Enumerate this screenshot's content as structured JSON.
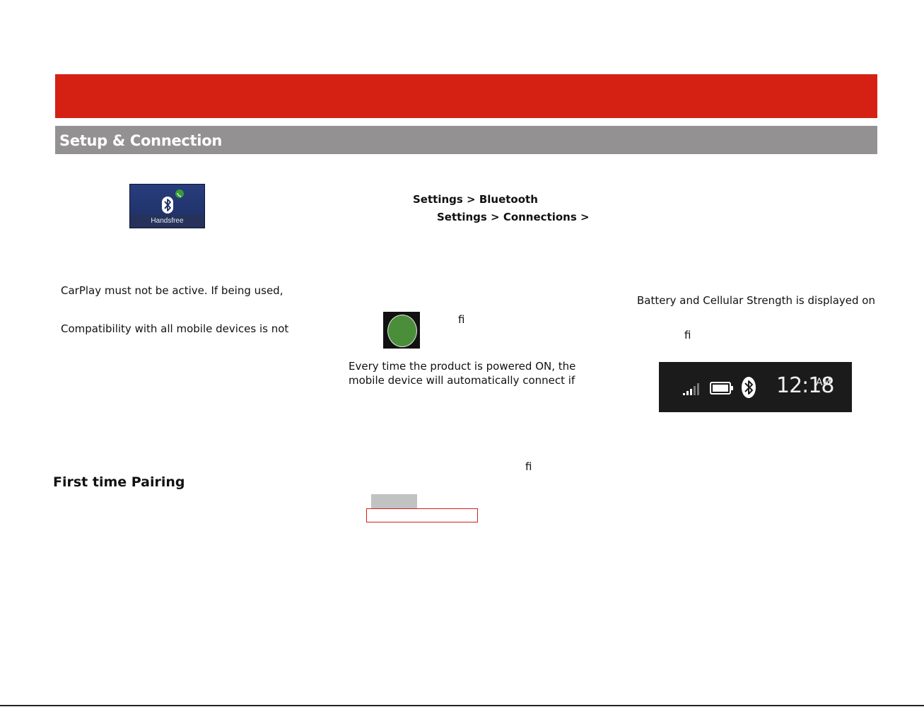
{
  "section": {
    "title": "Setup & Connection"
  },
  "handsfree_tile": {
    "label": "Handsfree"
  },
  "left_col": {
    "carplay_note": "CarPlay must not be active. If being used,",
    "compat_note": "Compatibility with all mobile devices is not"
  },
  "middle_col": {
    "path1": "Settings > Bluetooth",
    "path2": "Settings > Connections >",
    "fi_1": "ﬁ",
    "auto_connect_line1": "Every time the product is powered ON, the",
    "auto_connect_line2": "mobile device will automatically connect if",
    "fi_2": "ﬁ"
  },
  "right_col": {
    "battery_note": "Battery and Cellular Strength is displayed on",
    "fi_3": "ﬁ"
  },
  "status_bar": {
    "time": "12:18",
    "ampm": "AM",
    "icons": [
      "signal-icon",
      "battery-icon",
      "bluetooth-icon"
    ]
  },
  "first_pairing": {
    "heading": "First time Pairing"
  },
  "colors": {
    "header_red": "#d42114",
    "section_grey": "#939191",
    "handsfree_blue": "#283d7c",
    "button_green": "#4b8e3a"
  }
}
